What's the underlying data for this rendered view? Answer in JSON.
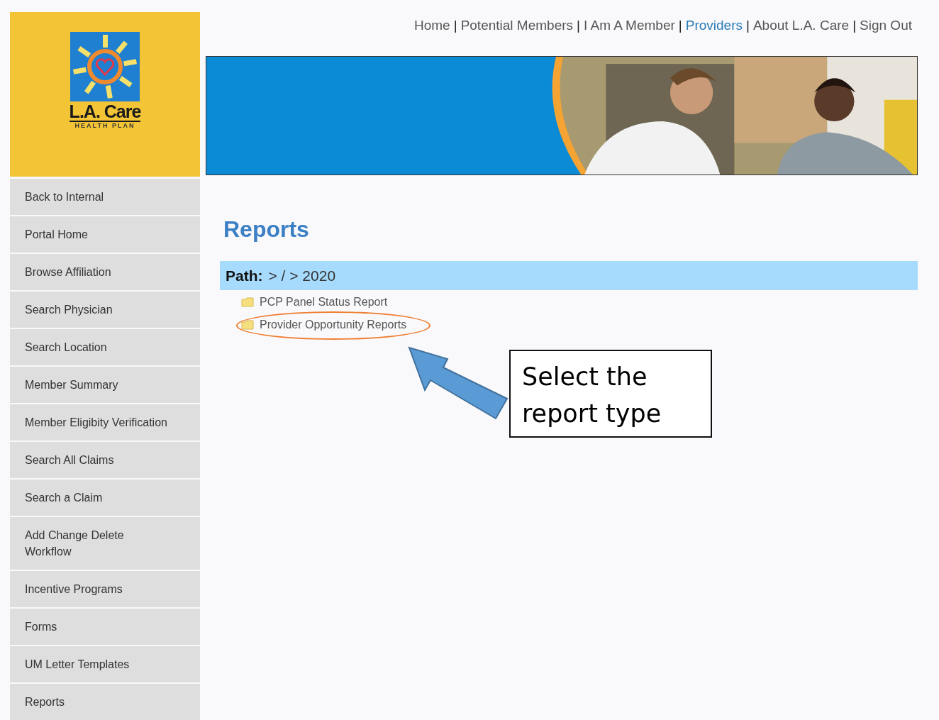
{
  "logo": {
    "name": "L.A. Care",
    "tagline": "HEALTH PLAN"
  },
  "nav": [
    {
      "label": "Home",
      "selected": false,
      "separator": "|"
    },
    {
      "label": "Potential Members",
      "selected": false,
      "separator": "|"
    },
    {
      "label": "I Am A Member",
      "selected": false,
      "separator": "|"
    },
    {
      "label": "Providers",
      "selected": true,
      "separator": "|"
    },
    {
      "label": "About L.A. Care",
      "selected": false,
      "separator": "|"
    },
    {
      "label": "Sign Out",
      "selected": false
    }
  ],
  "sidebar": {
    "items": [
      "Back to Internal",
      "Portal Home",
      "Browse Affiliation",
      "Search Physician",
      "Search Location",
      "Member Summary",
      "Member Eligibity Verification",
      "Search All Claims",
      "Search a Claim",
      "Add Change Delete Workflow",
      "Incentive Programs",
      "Forms",
      "UM Letter Templates",
      "Reports"
    ]
  },
  "page_title": "Reports",
  "path": {
    "label": "Path:",
    "value": "> / > 2020"
  },
  "reports": [
    {
      "label": "PCP Panel Status Report",
      "highlighted": false
    },
    {
      "label": "Provider Opportunity Reports",
      "highlighted": true
    }
  ],
  "callout": {
    "text": "Select the report type"
  }
}
